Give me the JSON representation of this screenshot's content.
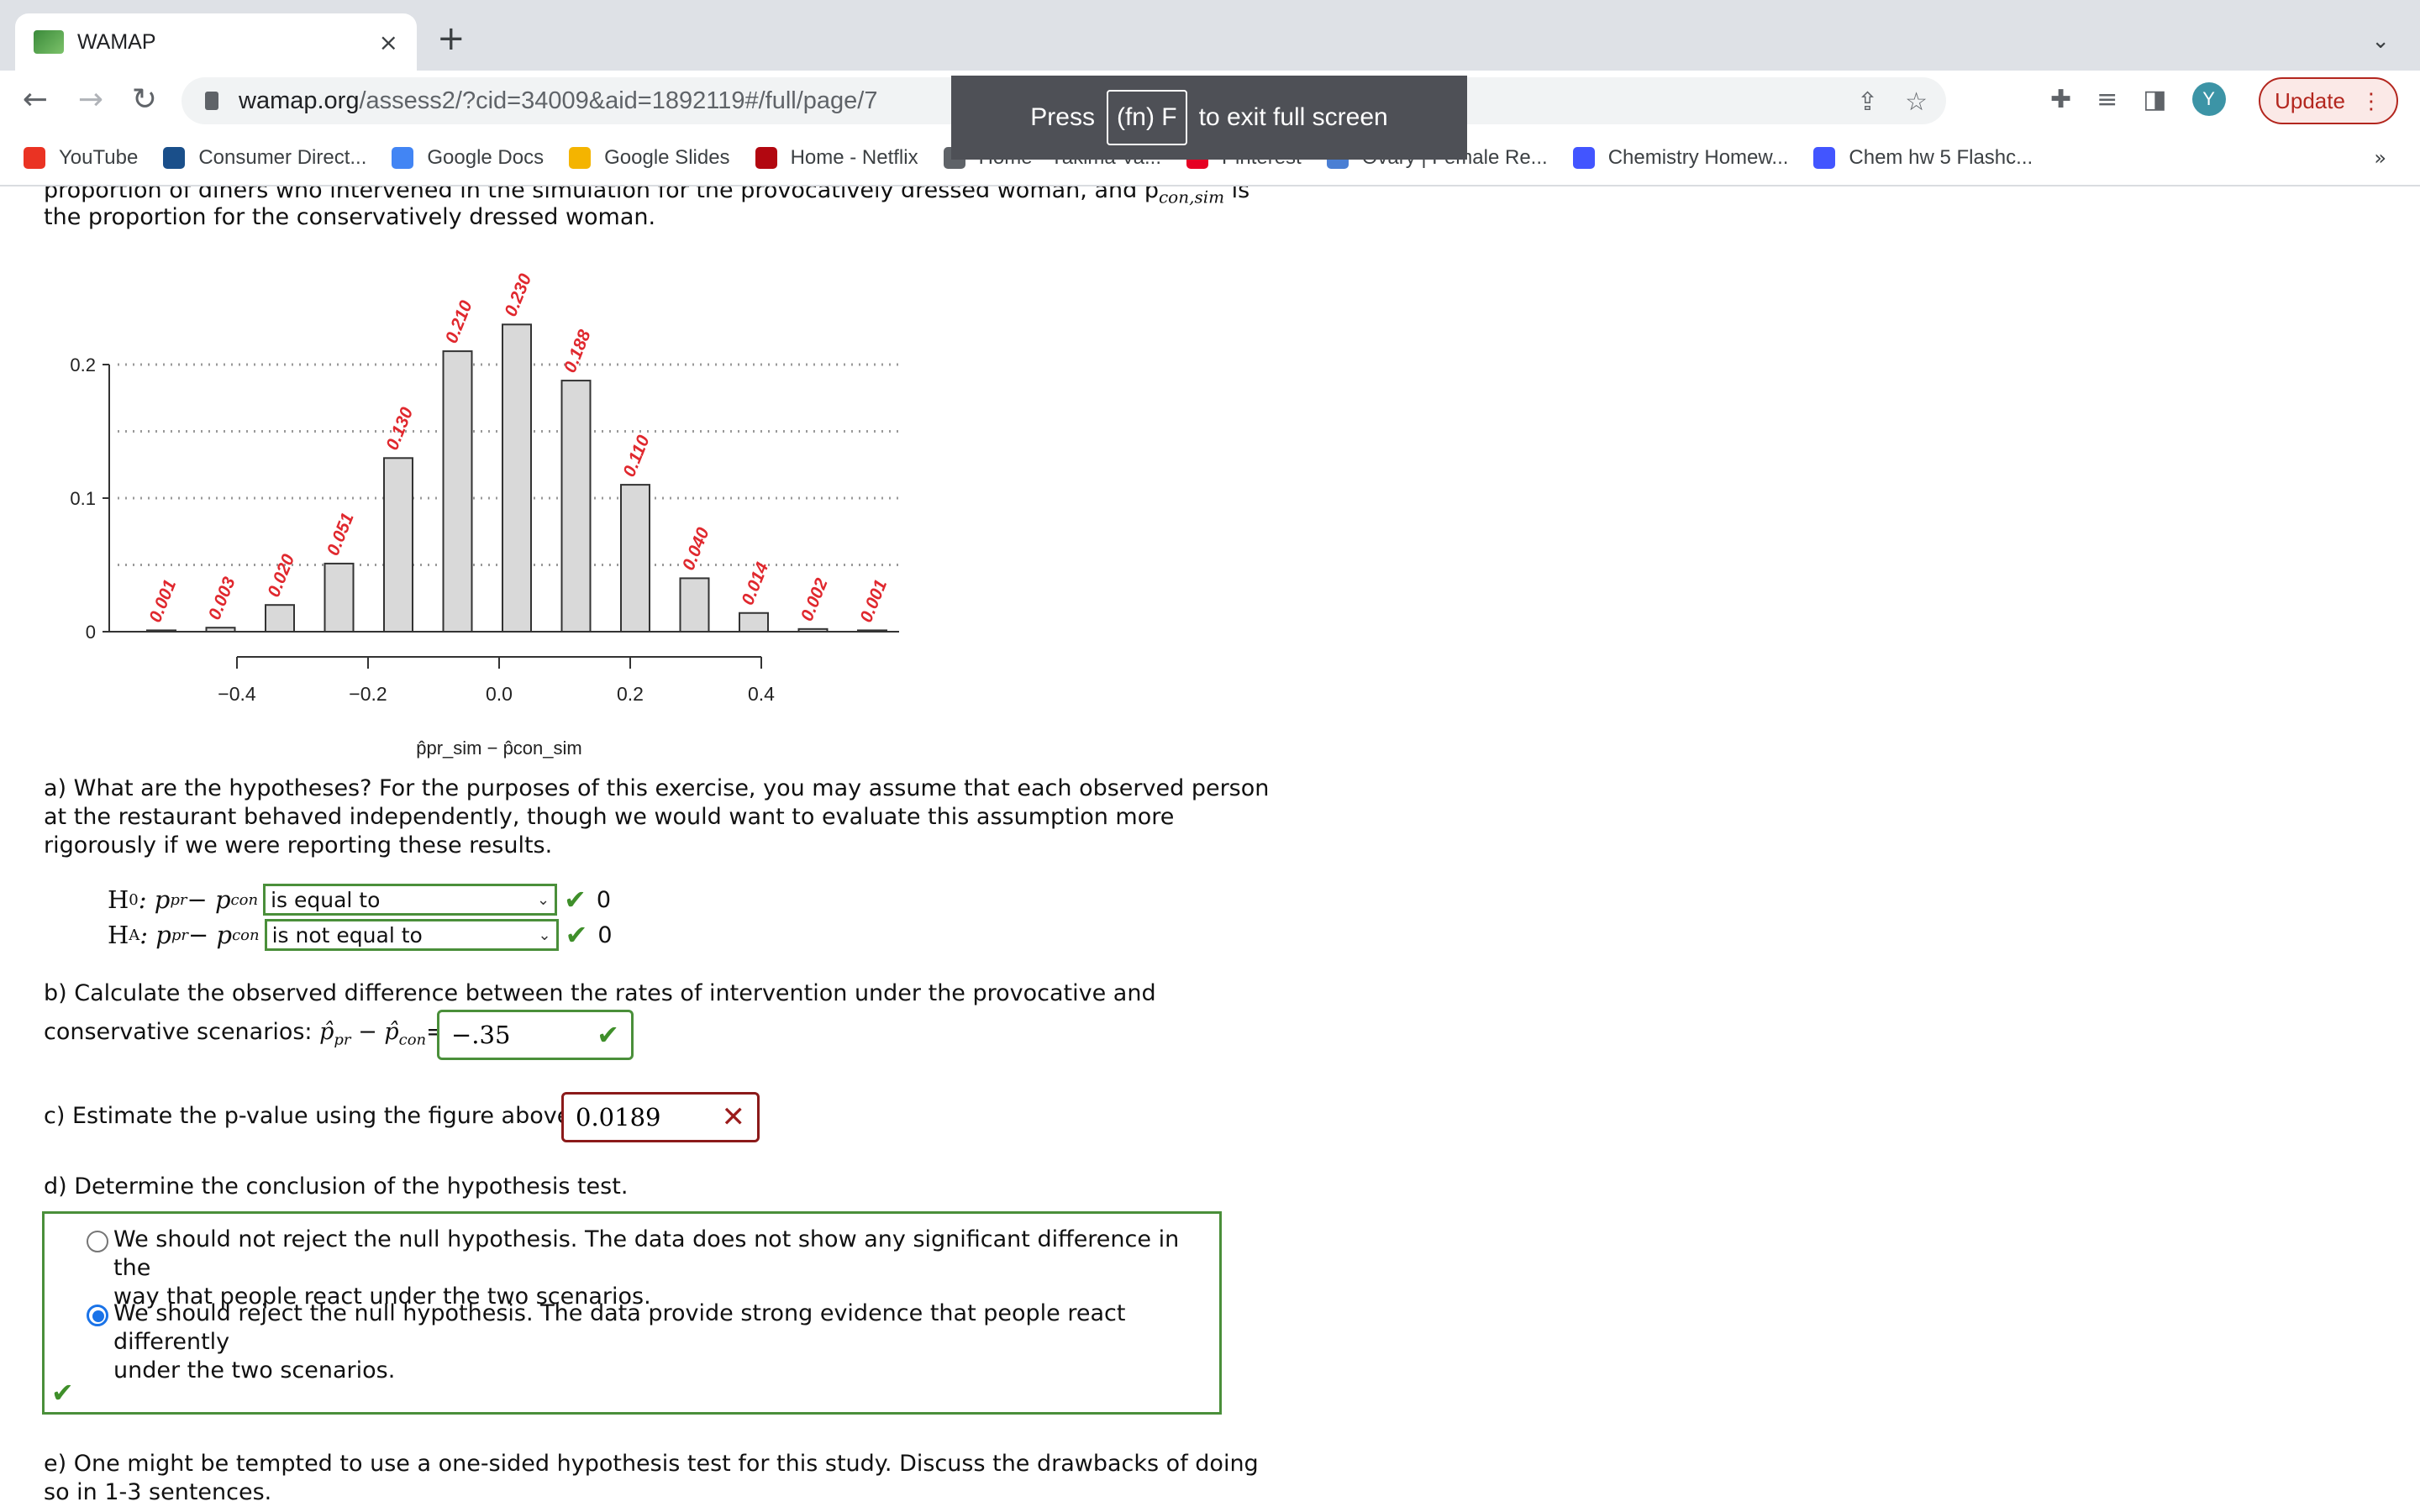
{
  "browser": {
    "tab_title": "WAMAP",
    "tab_close": "×",
    "new_tab": "+",
    "tab_menu": "⌄",
    "url_domain": "wamap.org",
    "url_path": "/assess2/?cid=34009&aid=1892119#/full/page/7",
    "avatar_letter": "Y",
    "update_label": "Update",
    "fullscreen_toast": {
      "press": "Press",
      "key": "(fn) F",
      "rest": "to exit full screen"
    },
    "bookmarks": [
      {
        "label": "YouTube",
        "icon": "youtube-icon",
        "color": "#ea3323"
      },
      {
        "label": "Consumer Direct...",
        "icon": "consumer-direct-icon",
        "color": "#1a4f8a"
      },
      {
        "label": "Google Docs",
        "icon": "google-docs-icon",
        "color": "#4285f4"
      },
      {
        "label": "Google Slides",
        "icon": "google-slides-icon",
        "color": "#f4b400"
      },
      {
        "label": "Home - Netflix",
        "icon": "netflix-icon",
        "color": "#b20710"
      },
      {
        "label": "Home - Yakima Va...",
        "icon": "globe-icon",
        "color": "#5f6368"
      },
      {
        "label": "Pinterest",
        "icon": "pinterest-icon",
        "color": "#e60023"
      },
      {
        "label": "Ovary | Female Re...",
        "icon": "search-icon",
        "color": "#4a7fd4"
      },
      {
        "label": "Chemistry Homew...",
        "icon": "quizlet-icon",
        "color": "#4255ff"
      },
      {
        "label": "Chem hw 5 Flashc...",
        "icon": "quizlet-icon",
        "color": "#4255ff"
      }
    ],
    "bookmarks_more": "»"
  },
  "question": {
    "intro_line1": "proportion of diners who intervened in the simulation for the provocatively dressed woman, and p",
    "intro_sub": "con,sim",
    "intro_tail": " is",
    "intro_line2": "the proportion for the conservatively dressed woman.",
    "part_a": [
      "a) What are the hypotheses? For the purposes of this exercise, you may assume that each observed person",
      "at the restaurant behaved independently, though we would want to evaluate this assumption more",
      "rigorously if we were reporting these results."
    ],
    "h0_label": "H",
    "h0_sub": "0",
    "ha_label": "H",
    "ha_sub": "A",
    "h_expr": ": p",
    "h_expr_sub1": "pr",
    "h_minus": " − p",
    "h_expr_sub2": "con",
    "h0_select": "is equal to",
    "ha_select": "is not equal to",
    "h0_value": "0",
    "ha_value": "0",
    "part_b_line1": "b) Calculate the observed difference between the rates of intervention under the provocative and",
    "part_b_line2": "conservative scenarios: ",
    "part_b_answer": "−.35",
    "part_c": "c) Estimate the p-value using the figure above.",
    "part_c_answer": "0.0189",
    "part_d": "d) Determine the conclusion of the hypothesis test.",
    "choices": [
      {
        "line1": "We should not reject the null hypothesis. The data does not show any significant difference in the",
        "line2": "way that people react under the two scenarios.",
        "selected": false
      },
      {
        "line1": "We should reject the null hypothesis. The data provide strong evidence that people react differently",
        "line2": "under the two scenarios.",
        "selected": true
      }
    ],
    "part_e_line1": "e) One might be tempted to use a one-sided hypothesis test for this study. Discuss the drawbacks of doing",
    "part_e_line2": "so in 1-3 sentences."
  },
  "chart_data": {
    "type": "bar",
    "title": "",
    "xlabel": "p̂pr_sim − p̂con_sim",
    "ylabel": "",
    "x": [
      -0.525,
      -0.425,
      -0.325,
      -0.225,
      -0.125,
      -0.025,
      0.075,
      0.175,
      0.275,
      0.375,
      0.475,
      0.575,
      0.675
    ],
    "x_centered": [
      -0.55,
      -0.45,
      -0.35,
      -0.25,
      -0.15,
      -0.05,
      0.05,
      0.15,
      0.25,
      0.35,
      0.45,
      0.55,
      0.65
    ],
    "values": [
      0.001,
      0.003,
      0.02,
      0.051,
      0.13,
      0.21,
      0.23,
      0.188,
      0.11,
      0.04,
      0.014,
      0.002,
      0.001
    ],
    "labels": [
      "0.001",
      "0.003",
      "0.020",
      "0.051",
      "0.130",
      "0.210",
      "0.230",
      "0.188",
      "0.110",
      "0.040",
      "0.014",
      "0.002",
      "0.001"
    ],
    "xticks": [
      -0.4,
      -0.2,
      0.0,
      0.2,
      0.4
    ],
    "xtick_labels": [
      "−0.4",
      "−0.2",
      "0.0",
      "0.2",
      "0.4"
    ],
    "yticks": [
      0,
      0.1,
      0.2
    ],
    "ytick_labels": [
      "0",
      "0.1",
      "0.2"
    ],
    "gridlines": [
      0.05,
      0.1,
      0.15,
      0.2
    ],
    "ylim": [
      0,
      0.2
    ],
    "grid": true,
    "bar_color": "#d9d9d9",
    "label_color": "#e0282e"
  }
}
